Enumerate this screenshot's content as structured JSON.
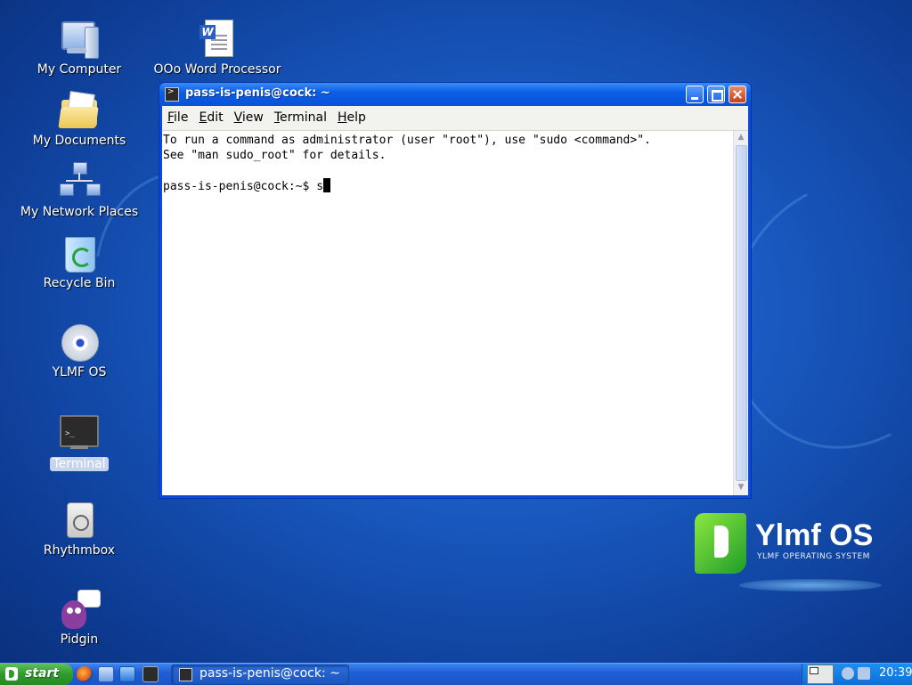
{
  "desktop": {
    "icons": [
      {
        "label": "My Computer"
      },
      {
        "label": "OOo Word Processor"
      },
      {
        "label": "My Documents"
      },
      {
        "label": "My Network Places"
      },
      {
        "label": "Recycle Bin"
      },
      {
        "label": "YLMF OS"
      },
      {
        "label": "Terminal"
      },
      {
        "label": "Rhythmbox"
      },
      {
        "label": "Pidgin"
      }
    ],
    "logo": {
      "name": "Ylmf OS",
      "subtitle": "YLMF OPERATING SYSTEM"
    }
  },
  "window": {
    "title": "pass-is-penis@cock: ~",
    "menu": [
      "File",
      "Edit",
      "View",
      "Terminal",
      "Help"
    ],
    "terminal": {
      "lines": [
        "To run a command as administrator (user \"root\"), use \"sudo <command>\".",
        "See \"man sudo_root\" for details.",
        ""
      ],
      "prompt": "pass-is-penis@cock:~$ ",
      "input": "s"
    }
  },
  "taskbar": {
    "start_label": "start",
    "task_label": "pass-is-penis@cock: ~",
    "clock": "20:39"
  },
  "colors": {
    "desktop_bg": "#1a5cc4",
    "titlebar": "#0b5fe6",
    "start_green": "#2f9b2c",
    "logo_green": "#1e9c2a"
  }
}
